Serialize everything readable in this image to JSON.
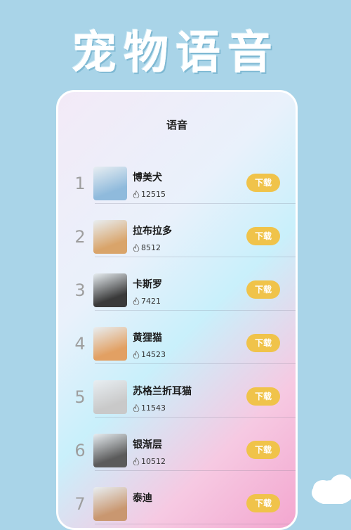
{
  "headline": "宠物语音",
  "screen": {
    "title": "语音"
  },
  "items": [
    {
      "rank": "1",
      "name": "博美犬",
      "plays": "12515",
      "action": "下载",
      "thumb_color": "#8fbadc"
    },
    {
      "rank": "2",
      "name": "拉布拉多",
      "plays": "8512",
      "action": "下载",
      "thumb_color": "#d9a46a"
    },
    {
      "rank": "3",
      "name": "卡斯罗",
      "plays": "7421",
      "action": "下载",
      "thumb_color": "#3a3a3a"
    },
    {
      "rank": "4",
      "name": "黄狸猫",
      "plays": "14523",
      "action": "下载",
      "thumb_color": "#e2a063"
    },
    {
      "rank": "5",
      "name": "苏格兰折耳猫",
      "plays": "11543",
      "action": "下载",
      "thumb_color": "#c9c9c9"
    },
    {
      "rank": "6",
      "name": "银渐层",
      "plays": "10512",
      "action": "下载",
      "thumb_color": "#5b5b5b"
    },
    {
      "rank": "7",
      "name": "泰迪",
      "plays": "",
      "action": "下载",
      "thumb_color": "#c99770"
    }
  ],
  "colors": {
    "background": "#a9d4e8",
    "download_button": "#f0c34a"
  }
}
